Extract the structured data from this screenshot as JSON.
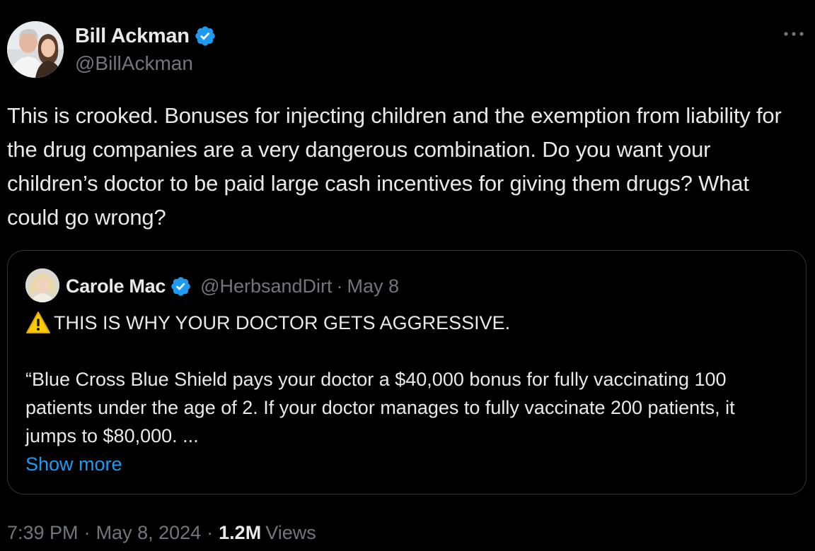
{
  "author": {
    "name": "Bill Ackman",
    "handle": "@BillAckman",
    "verified": true,
    "avatar_icon": "profile-photo"
  },
  "more_icon": "more-horizontal-icon",
  "tweet_text": "This is crooked. Bonuses for injecting children and the exemption from liability for the drug companies are a very dangerous combination. Do you want your children’s doctor to be paid large cash incentives for giving them drugs?  What could go wrong?",
  "quote": {
    "name": "Carole Mac",
    "handle": "@HerbsandDirt",
    "separator": "·",
    "date": "May 8",
    "verified": true,
    "headline_icon": "warning-icon",
    "headline": "THIS IS WHY YOUR DOCTOR GETS AGGRESSIVE.",
    "body": "“Blue Cross Blue Shield pays your doctor a $40,000 bonus for fully vaccinating 100 patients under the age of 2. If your doctor manages to fully vaccinate 200 patients, it jumps to $80,000. ...",
    "show_more": "Show more"
  },
  "meta": {
    "time": "7:39 PM",
    "separator": "·",
    "date": "May 8, 2024",
    "views_count": "1.2M",
    "views_label": "Views"
  },
  "colors": {
    "background": "#000000",
    "text": "#e7e9ea",
    "secondary": "#71767b",
    "link": "#1d9bf0",
    "border": "#2f3336",
    "verified": "#1d9bf0"
  }
}
